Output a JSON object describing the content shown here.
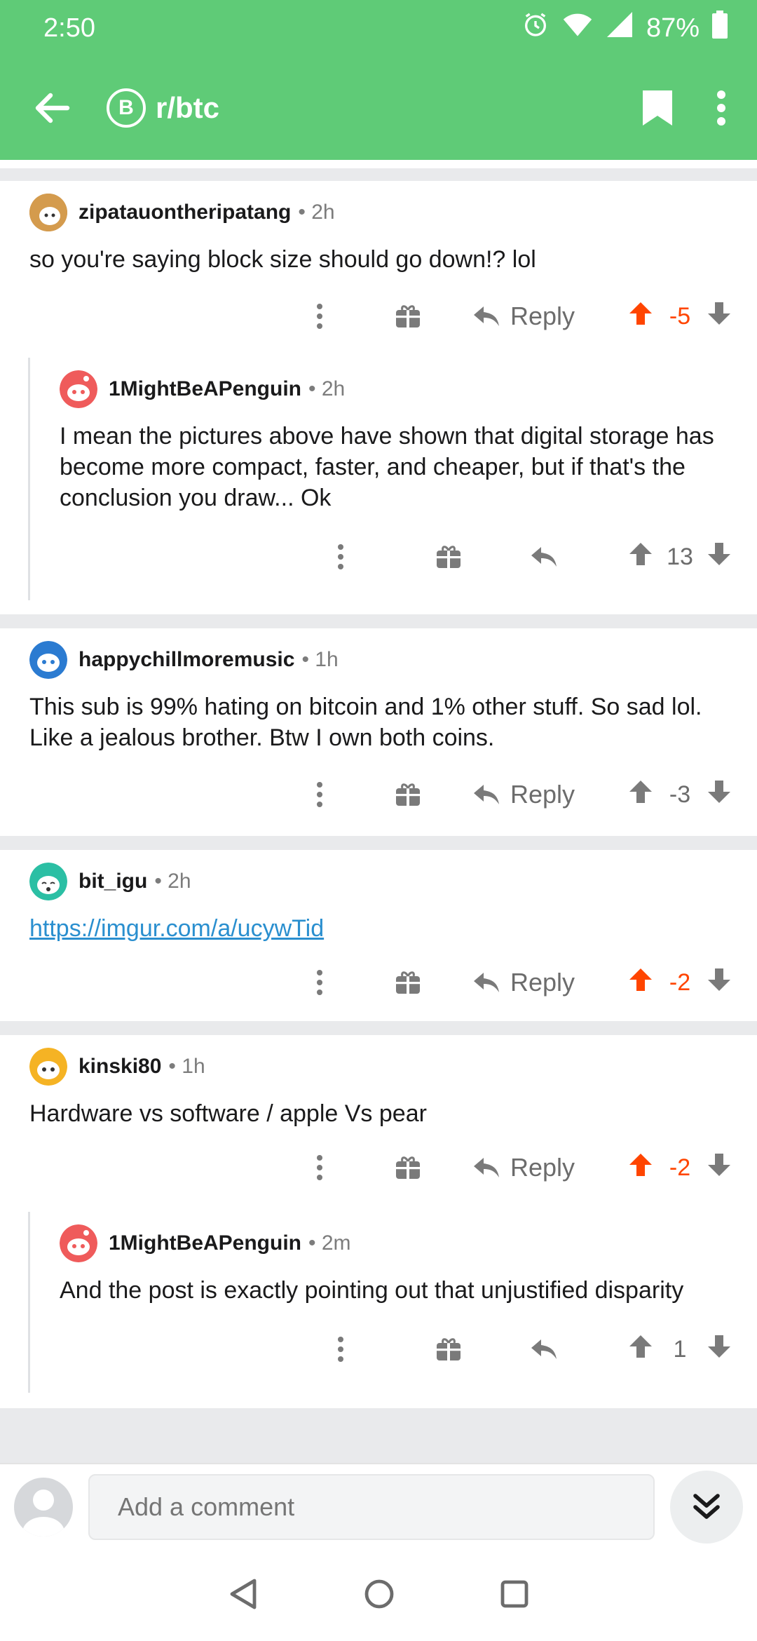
{
  "status": {
    "time": "2:50",
    "battery": "87%"
  },
  "appbar": {
    "subreddit": "r/btc",
    "sub_icon_glyph": "B"
  },
  "labels": {
    "reply": "Reply"
  },
  "comments": [
    {
      "author": "zipatauontheripatang",
      "time": "2h",
      "text": "so you're saying block size should go down!?  lol",
      "score": "-5",
      "score_color": "#ff4500"
    },
    {
      "author": "1MightBeAPenguin",
      "time": "2h",
      "text": "I mean the pictures above have shown that digital storage has become more compact, faster, and cheaper, but if that's the conclusion you draw... Ok",
      "score": "13"
    },
    {
      "author": "happychillmoremusic",
      "time": "1h",
      "text": "This sub is 99% hating on bitcoin and 1% other stuff. So sad lol. Like a jealous brother. Btw I own both coins.",
      "score": "-3"
    },
    {
      "author": "bit_igu",
      "time": "2h",
      "link": "https://imgur.com/a/ucywTid",
      "score": "-2",
      "score_color": "#ff4500"
    },
    {
      "author": "kinski80",
      "time": "1h",
      "text": "Hardware vs software / apple Vs pear",
      "score": "-2",
      "score_color": "#ff4500"
    },
    {
      "author": "1MightBeAPenguin",
      "time": "2m",
      "text": "And the post is exactly pointing out that unjustified disparity",
      "score": "1"
    }
  ],
  "composer": {
    "placeholder": "Add a comment"
  },
  "colors": {
    "header_green": "#5fcb77",
    "upvote_orange": "#ff4500",
    "link_blue": "#2a8fcf"
  }
}
